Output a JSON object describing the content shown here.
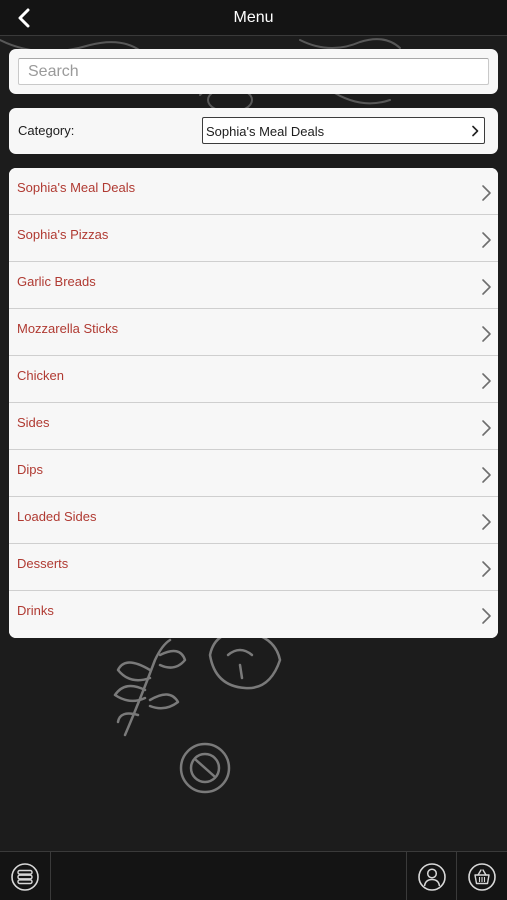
{
  "header": {
    "title": "Menu",
    "back_icon": "chevron-left-icon"
  },
  "search": {
    "placeholder": "Search",
    "value": ""
  },
  "category": {
    "label": "Category:",
    "selected": "Sophia's Meal Deals"
  },
  "menu_items": [
    {
      "label": "Sophia's Meal Deals"
    },
    {
      "label": "Sophia's Pizzas"
    },
    {
      "label": "Garlic Breads"
    },
    {
      "label": "Mozzarella Sticks"
    },
    {
      "label": "Chicken"
    },
    {
      "label": "Sides"
    },
    {
      "label": "Dips"
    },
    {
      "label": "Loaded Sides"
    },
    {
      "label": "Desserts"
    },
    {
      "label": "Drinks"
    }
  ],
  "bottom_bar": {
    "left_icon": "menu-stack-icon",
    "account_icon": "user-icon",
    "basket_icon": "basket-icon"
  },
  "colors": {
    "background": "#1c1c1c",
    "bar": "#141414",
    "card": "#f7f7f7",
    "item_text": "#b03a32"
  }
}
